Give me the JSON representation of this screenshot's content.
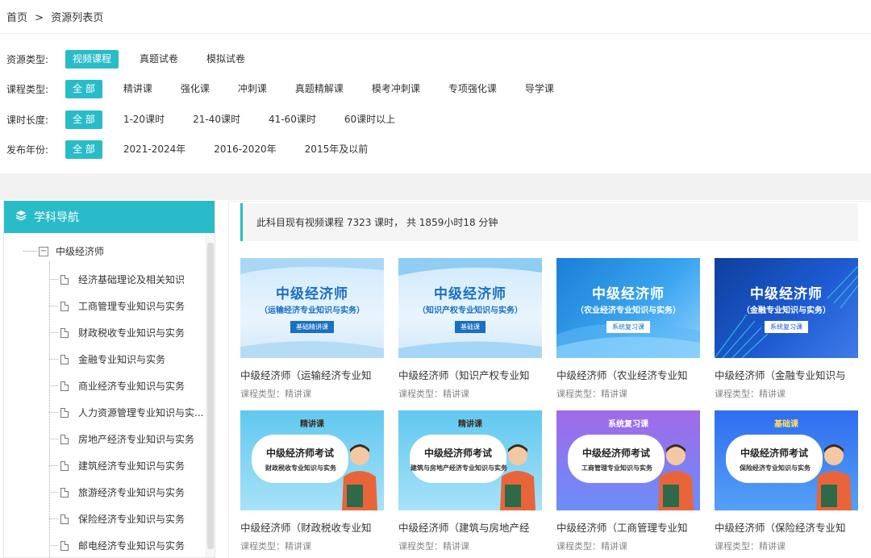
{
  "breadcrumb": {
    "home": "首页",
    "sep": ">",
    "current": "资源列表页"
  },
  "filters": {
    "resource_type": {
      "label": "资源类型:",
      "options": [
        "视频课程",
        "真题试卷",
        "模拟试卷"
      ],
      "active": 0
    },
    "course_type": {
      "label": "课程类型:",
      "options": [
        "全 部",
        "精讲课",
        "强化课",
        "冲刺课",
        "真题精解课",
        "模考冲刺课",
        "专项强化课",
        "导学课"
      ],
      "active": 0
    },
    "duration": {
      "label": "课时长度:",
      "options": [
        "全 部",
        "1-20课时",
        "21-40课时",
        "41-60课时",
        "60课时以上"
      ],
      "active": 0
    },
    "year": {
      "label": "发布年份:",
      "options": [
        "全 部",
        "2021-2024年",
        "2016-2020年",
        "2015年及以前"
      ],
      "active": 0
    }
  },
  "sidebar": {
    "title": "学科导航",
    "root": "中级经济师",
    "items": [
      "经济基础理论及相关知识",
      "工商管理专业知识与实务",
      "财政税收专业知识与实务",
      "金融专业知识与实务",
      "商业经济专业知识与实务",
      "人力资源管理专业知识与实...",
      "房地产经济专业知识与实务",
      "建筑经济专业知识与实务",
      "旅游经济专业知识与实务",
      "保险经济专业知识与实务",
      "邮电经济专业知识与实务"
    ]
  },
  "summary": "此科目现有视频课程 7323 课时， 共 1859小时18 分钟",
  "cards": [
    {
      "title": "中级经济师（运输经济专业知",
      "type": "课程类型：精讲课",
      "thumb_title": "中级经济师",
      "thumb_sub": "（运输经济专业知识与实务）",
      "thumb_badge": "基础精讲课"
    },
    {
      "title": "中级经济师（知识产权专业知",
      "type": "课程类型：精讲课",
      "thumb_title": "中级经济师",
      "thumb_sub": "（知识产权专业知识与实务）",
      "thumb_badge": "基础课"
    },
    {
      "title": "中级经济师（农业经济专业知",
      "type": "课程类型：精讲课",
      "thumb_title": "中级经济师",
      "thumb_sub": "（农业经济专业知识与实务）",
      "thumb_badge": "系统复习课"
    },
    {
      "title": "中级经济师（金融专业知识与",
      "type": "课程类型：精讲课",
      "thumb_title": "中级经济师",
      "thumb_sub": "（金融专业知识与实务）",
      "thumb_badge": "系统复习课"
    },
    {
      "title": "中级经济师（财政税收专业知",
      "type": "课程类型：精讲课",
      "thumb_head": "精讲课",
      "thumb_title": "中级经济师考试",
      "thumb_sub": "财政税收专业知识与实务"
    },
    {
      "title": "中级经济师（建筑与房地产经",
      "type": "课程类型：精讲课",
      "thumb_head": "精讲课",
      "thumb_title": "中级经济师考试",
      "thumb_sub": "建筑与房地产经济专业知识与实务"
    },
    {
      "title": "中级经济师（工商管理专业知",
      "type": "课程类型：精讲课",
      "thumb_head": "系统复习课",
      "thumb_title": "中级经济师考试",
      "thumb_sub": "工商管理专业知识与实务"
    },
    {
      "title": "中级经济师（保险经济专业知",
      "type": "课程类型：精讲课",
      "thumb_head": "基础课",
      "thumb_title": "中级经济师考试",
      "thumb_sub": "保险经济专业知识与实务"
    }
  ],
  "colors": {
    "accent": "#29bcc8"
  },
  "icons": {
    "sidebar_head": "layers-icon",
    "tree_toggle": "minus-box-icon",
    "leaf": "document-icon"
  }
}
